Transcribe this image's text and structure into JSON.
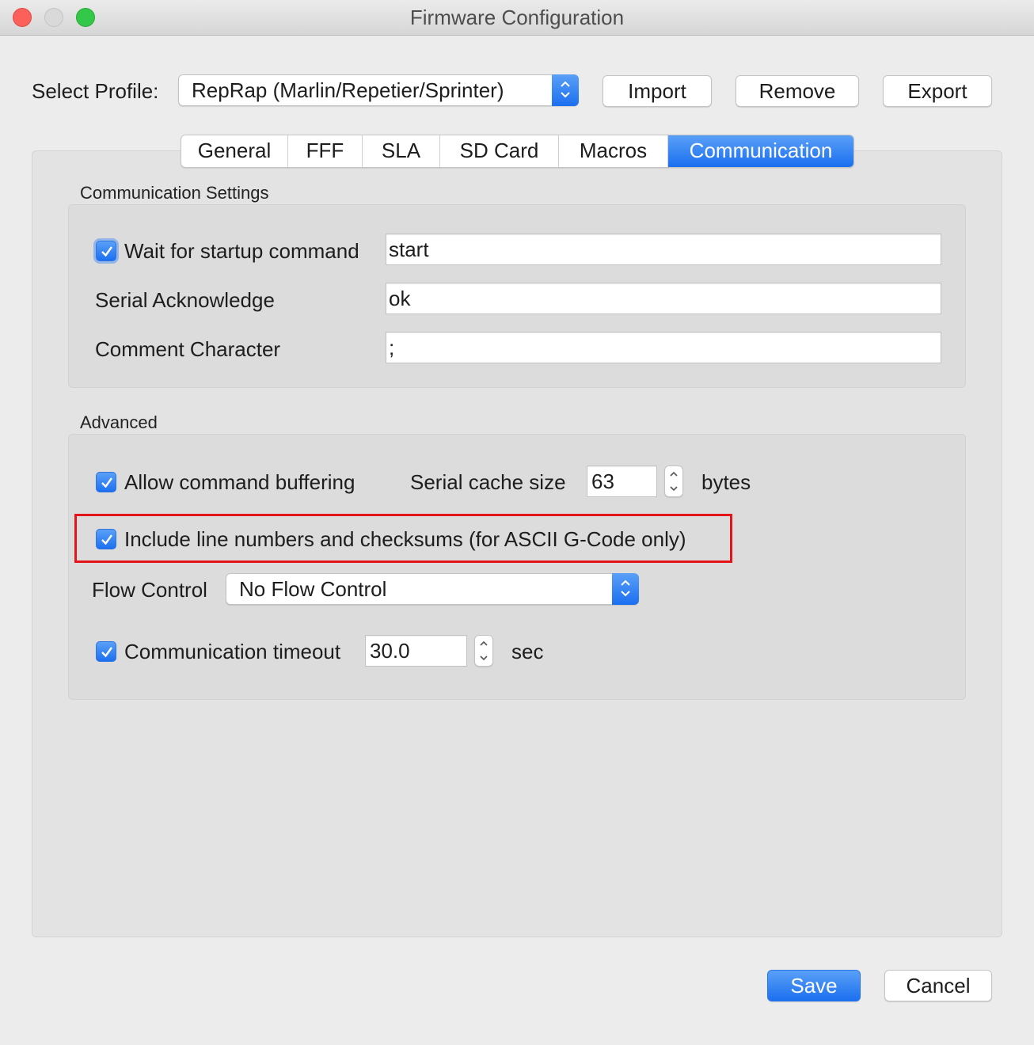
{
  "window": {
    "title": "Firmware Configuration"
  },
  "profile": {
    "label": "Select Profile:",
    "selected": "RepRap (Marlin/Repetier/Sprinter)",
    "buttons": {
      "import": "Import",
      "remove": "Remove",
      "export": "Export"
    }
  },
  "tabs": [
    {
      "label": "General",
      "active": false
    },
    {
      "label": "FFF",
      "active": false
    },
    {
      "label": "SLA",
      "active": false
    },
    {
      "label": "SD Card",
      "active": false
    },
    {
      "label": "Macros",
      "active": false
    },
    {
      "label": "Communication",
      "active": true
    }
  ],
  "communication_settings": {
    "heading": "Communication Settings",
    "wait_startup": {
      "label": "Wait for startup command",
      "checked": true,
      "value": "start"
    },
    "serial_ack": {
      "label": "Serial Acknowledge",
      "value": "ok"
    },
    "comment_char": {
      "label": "Comment Character",
      "value": ";"
    }
  },
  "advanced": {
    "heading": "Advanced",
    "allow_buffering": {
      "label": "Allow command buffering",
      "checked": true
    },
    "cache": {
      "label": "Serial cache size",
      "value": "63",
      "unit": "bytes"
    },
    "line_numbers": {
      "label": "Include line numbers and checksums (for ASCII G-Code only)",
      "checked": true
    },
    "flow_control": {
      "label": "Flow Control",
      "selected": "No Flow Control"
    },
    "timeout": {
      "label": "Communication timeout",
      "checked": true,
      "value": "30.0",
      "unit": "sec"
    }
  },
  "footer": {
    "save": "Save",
    "cancel": "Cancel"
  },
  "colors": {
    "accent": "#1b6ff0",
    "highlight": "#e3141a"
  }
}
